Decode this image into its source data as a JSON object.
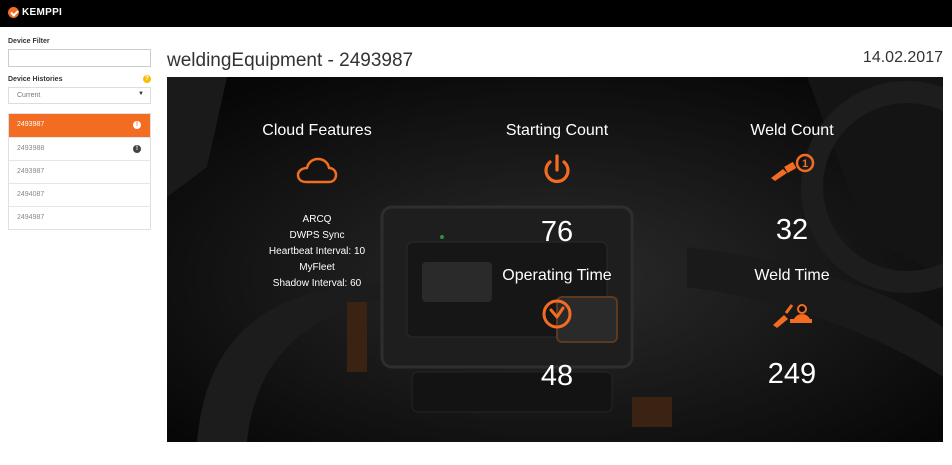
{
  "brand": {
    "name": "KEMPPI",
    "accent": "#f26d21"
  },
  "sidebar": {
    "filter_label": "Device Filter",
    "filter_value": "",
    "histories_label": "Device Histories",
    "histories_select": "Current",
    "devices": [
      {
        "label": "2493987",
        "active": true,
        "alert": "!"
      },
      {
        "label": "2493988",
        "active": false,
        "alert": "!"
      },
      {
        "label": "2493987",
        "active": false
      },
      {
        "label": "2494087",
        "active": false
      },
      {
        "label": "2494987",
        "active": false
      }
    ]
  },
  "header": {
    "title": "weldingEquipment - 2493987",
    "date": "14.02.2017"
  },
  "cards": {
    "cloud": {
      "title": "Cloud Features",
      "icon": "cloud-icon",
      "features": [
        "ARCQ",
        "DWPS Sync",
        "Heartbeat Interval: 10",
        "MyFleet",
        "Shadow Interval: 60"
      ]
    },
    "starting": {
      "title": "Starting Count",
      "icon": "power-icon",
      "value": "76"
    },
    "weld_count": {
      "title": "Weld Count",
      "icon": "welding-torch-count-icon",
      "value": "32"
    },
    "operating": {
      "title": "Operating Time",
      "icon": "clock-icon",
      "value": "48"
    },
    "weld_time": {
      "title": "Weld Time",
      "icon": "welding-torch-time-icon",
      "value": "249"
    }
  }
}
